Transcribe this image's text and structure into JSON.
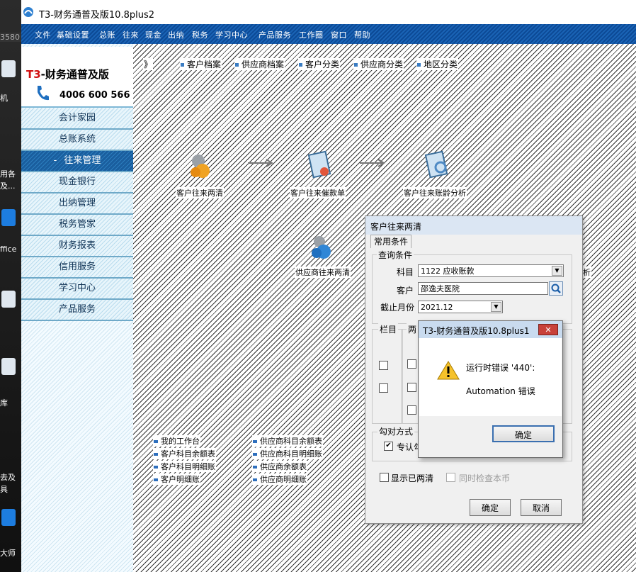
{
  "desktop": {
    "texts": [
      "3580",
      "机",
      "用各",
      "及...",
      "ffice",
      "库",
      "去及",
      "具",
      "大师"
    ]
  },
  "window": {
    "title": "T3-财务通普及版10.8plus2",
    "icon": "app-icon"
  },
  "menu": [
    "文件",
    "基础设置",
    "总账",
    "往来",
    "现金",
    "出纳",
    "税务",
    "学习中心",
    "产品服务",
    "工作圈",
    "窗口",
    "帮助"
  ],
  "brand": {
    "name_prefix": "T3",
    "name_rest": "-财务通普及版",
    "phone": "4006 600 566",
    "phone_icon": "phone-icon"
  },
  "nav": [
    {
      "label": "会计家园"
    },
    {
      "label": "总账系统"
    },
    {
      "label": "往来管理",
      "active": true,
      "prefix": "-"
    },
    {
      "label": "现金银行"
    },
    {
      "label": "出纳管理"
    },
    {
      "label": "税务管家"
    },
    {
      "label": "财务报表"
    },
    {
      "label": "信用服务"
    },
    {
      "label": "学习中心"
    },
    {
      "label": "产品服务"
    }
  ],
  "toolbar": {
    "marker": "》",
    "items": [
      "客户档案",
      "供应商档案",
      "客户分类",
      "供应商分类",
      "地区分类"
    ]
  },
  "flow": {
    "items": [
      "客户往来两清",
      "客户往来催款单",
      "客户往来账龄分析",
      "供应商往来两清"
    ],
    "partial_label": "析"
  },
  "links": {
    "col1": [
      "我的工作台",
      "客户科目余额表",
      "客户科目明细账",
      "客户明细账"
    ],
    "col2": [
      "供应商科目余额表",
      "供应商科目明细账",
      "供应商余额表",
      "供应商明细账"
    ]
  },
  "dialog": {
    "title": "客户往来两清",
    "tab": "常用条件",
    "query_group": "查询条件",
    "subject_label": "科目",
    "subject_value": "1122 应收账款",
    "customer_label": "客户",
    "customer_value": "邵逸夫医院",
    "month_label": "截止月份",
    "month_value": "2021.12",
    "column_group": "栏目",
    "two_group": "两",
    "match_group": "勾对方式",
    "match_option": "专认勾",
    "show_cleared": "显示已两清",
    "check_currency": "同时检查本币",
    "ok": "确定",
    "cancel": "取消"
  },
  "error": {
    "title": "T3-财务通普及版10.8plus1",
    "close": "✕",
    "line1": "运行时错误 '440':",
    "line2": "Automation 错误",
    "ok": "确定",
    "icon": "warning-icon"
  }
}
